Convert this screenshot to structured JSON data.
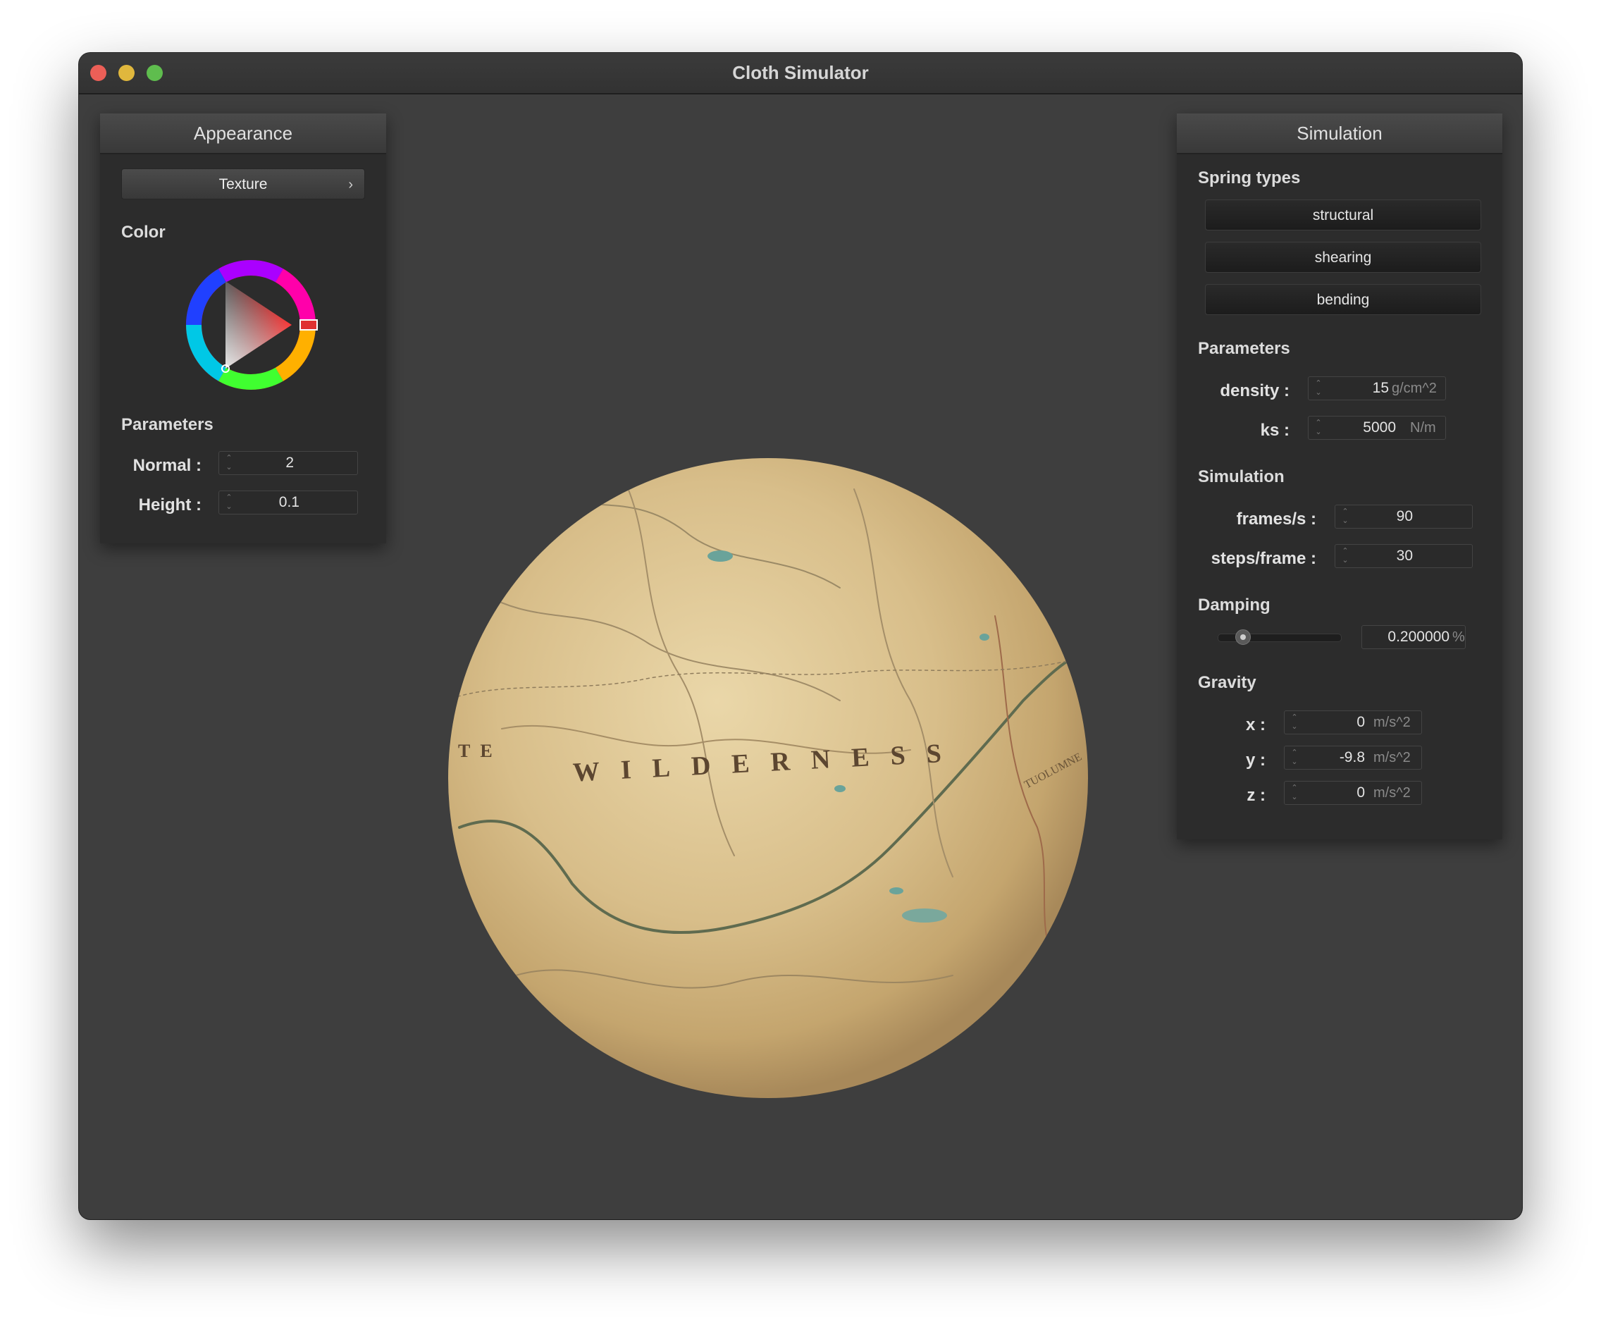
{
  "window": {
    "title": "Cloth Simulator"
  },
  "appearance": {
    "header": "Appearance",
    "texture_button": "Texture",
    "color_label": "Color",
    "parameters_label": "Parameters",
    "normal": {
      "label": "Normal :",
      "value": "2"
    },
    "height": {
      "label": "Height :",
      "value": "0.1"
    },
    "selected_hue_color": "#ff0000"
  },
  "simulation_panel": {
    "header": "Simulation",
    "spring_types_label": "Spring types",
    "spring_types": [
      "structural",
      "shearing",
      "bending"
    ],
    "parameters_label": "Parameters",
    "density": {
      "label": "density :",
      "value": "15",
      "unit": "g/cm^2"
    },
    "ks": {
      "label": "ks :",
      "value": "5000",
      "unit": "N/m"
    },
    "simulation_label": "Simulation",
    "frames": {
      "label": "frames/s :",
      "value": "90"
    },
    "steps": {
      "label": "steps/frame :",
      "value": "30"
    },
    "damping_label": "Damping",
    "damping": {
      "value": "0.200000",
      "unit": "%",
      "slider_fraction": 0.2
    },
    "gravity_label": "Gravity",
    "gravity": {
      "x": {
        "label": "x :",
        "value": "0",
        "unit": "m/s^2"
      },
      "y": {
        "label": "y :",
        "value": "-9.8",
        "unit": "m/s^2"
      },
      "z": {
        "label": "z :",
        "value": "0",
        "unit": "m/s^2"
      }
    }
  },
  "scene": {
    "sphere_text": "WILDERNESS",
    "sphere_edge_text": "TE",
    "sphere_road_text": "TUOLUMNE",
    "sphere_color": "#d9c18f"
  }
}
